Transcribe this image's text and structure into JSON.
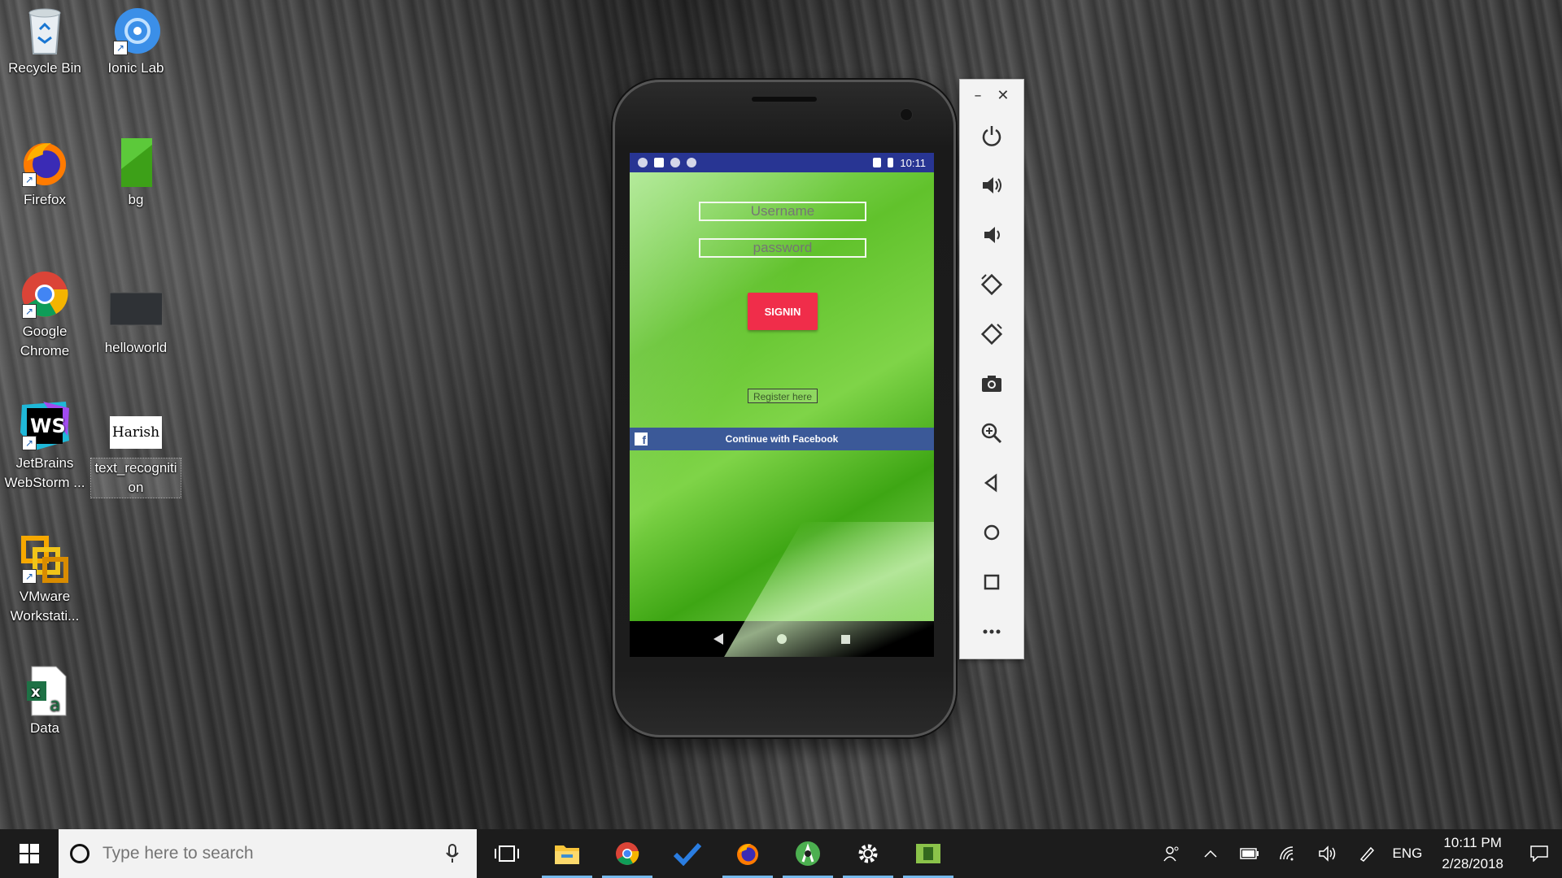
{
  "desktop": {
    "icons": [
      {
        "label": "Recycle Bin"
      },
      {
        "label": "Ionic Lab"
      },
      {
        "label": "Firefox"
      },
      {
        "label": "bg"
      },
      {
        "label": "Google Chrome"
      },
      {
        "label": "helloworld"
      },
      {
        "label": "JetBrains WebStorm ..."
      },
      {
        "label": "text_recogniti on",
        "thumb_text": "Harish"
      },
      {
        "label": "VMware Workstati..."
      },
      {
        "label": "Data"
      }
    ]
  },
  "emulator": {
    "statusbar": {
      "time": "10:11"
    },
    "app": {
      "username_placeholder": "Username",
      "password_placeholder": "password",
      "signin_label": "SIGNIN",
      "register_label": "Register here",
      "facebook_label": "Continue with Facebook"
    },
    "toolbar": {
      "minimize": "–",
      "close": "✕",
      "buttons": [
        "power-icon",
        "volume-up-icon",
        "volume-down-icon",
        "rotate-left-icon",
        "rotate-right-icon",
        "camera-icon",
        "zoom-icon",
        "back-icon",
        "home-icon",
        "overview-icon",
        "more-icon"
      ]
    }
  },
  "taskbar": {
    "search_placeholder": "Type here to search",
    "apps": [
      "task-view",
      "file-explorer",
      "chrome",
      "visual-studio",
      "firefox",
      "android-studio",
      "settings",
      "app-green"
    ],
    "tray": {
      "language": "ENG",
      "time": "10:11 PM",
      "date": "2/28/2018"
    }
  },
  "colors": {
    "statusbar": "#283593",
    "signin": "#f02d4a",
    "facebook": "#3b5998",
    "taskbar": "#1c1c1c"
  }
}
